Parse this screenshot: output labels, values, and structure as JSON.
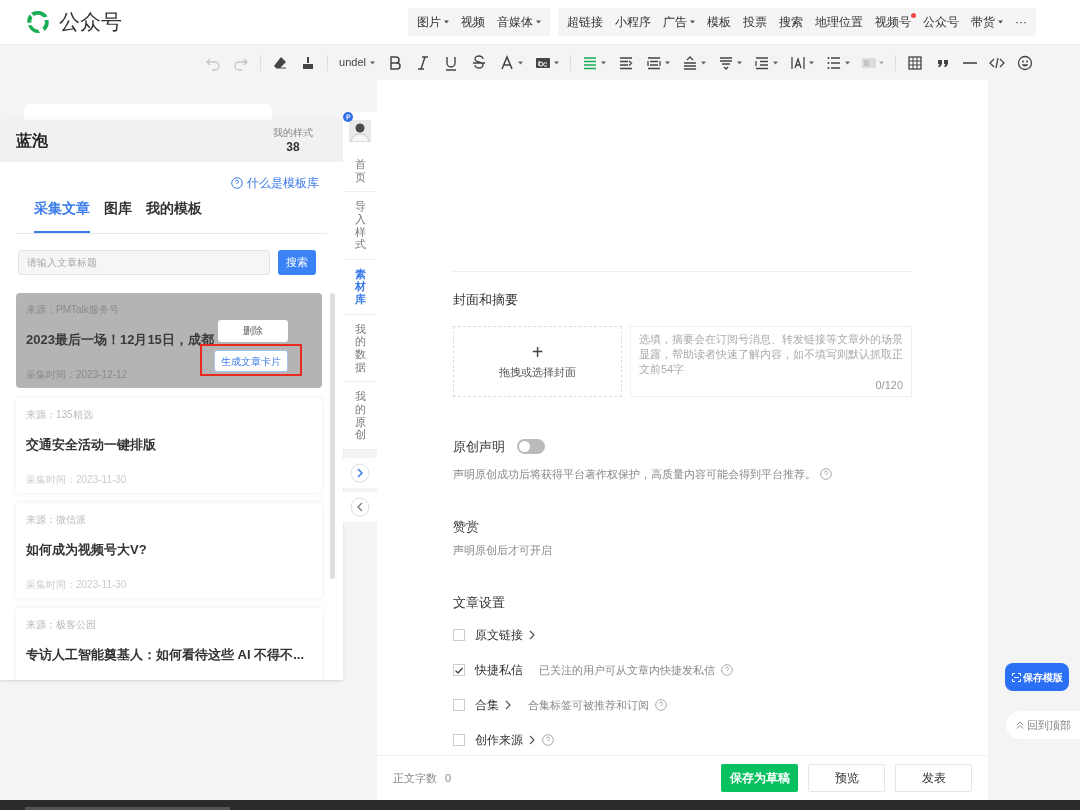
{
  "app": {
    "title": "公众号"
  },
  "insert_groups": [
    {
      "items": [
        {
          "label": "图片",
          "dropdown": true,
          "notification": false
        },
        {
          "label": "视频",
          "dropdown": false,
          "notification": false
        },
        {
          "label": "音媒体",
          "dropdown": true,
          "notification": false
        }
      ]
    },
    {
      "items": [
        {
          "label": "超链接",
          "dropdown": false,
          "notification": false
        },
        {
          "label": "小程序",
          "dropdown": false,
          "notification": false
        },
        {
          "label": "广告",
          "dropdown": true,
          "notification": false
        },
        {
          "label": "模板",
          "dropdown": false,
          "notification": false
        },
        {
          "label": "投票",
          "dropdown": false,
          "notification": false
        },
        {
          "label": "搜索",
          "dropdown": false,
          "notification": false
        },
        {
          "label": "地理位置",
          "dropdown": false,
          "notification": false
        },
        {
          "label": "视频号",
          "dropdown": false,
          "notification": true
        },
        {
          "label": "公众号",
          "dropdown": false,
          "notification": false
        },
        {
          "label": "带货",
          "dropdown": true,
          "notification": false
        },
        {
          "label": "···",
          "dropdown": false,
          "notification": false
        }
      ]
    }
  ],
  "toolbar": [
    {
      "kind": "undo",
      "disabled": true
    },
    {
      "kind": "redo",
      "disabled": true
    },
    {
      "kind": "separator"
    },
    {
      "kind": "eraser"
    },
    {
      "kind": "brush"
    },
    {
      "kind": "separator"
    },
    {
      "kind": "font",
      "label": "undel",
      "dropdown": true
    },
    {
      "kind": "bold"
    },
    {
      "kind": "italic"
    },
    {
      "kind": "underline"
    },
    {
      "kind": "strike"
    },
    {
      "kind": "color",
      "dropdown": true
    },
    {
      "kind": "highlight",
      "dropdown": true
    },
    {
      "kind": "separator"
    },
    {
      "kind": "align",
      "active": true,
      "dropdown": true
    },
    {
      "kind": "indent"
    },
    {
      "kind": "center",
      "dropdown": true
    },
    {
      "kind": "line-height",
      "dropdown": true
    },
    {
      "kind": "spacing",
      "dropdown": true
    },
    {
      "kind": "paragraph",
      "dropdown": true
    },
    {
      "kind": "letter-spacing",
      "dropdown": true
    },
    {
      "kind": "list",
      "dropdown": true
    },
    {
      "kind": "image-layout",
      "disabled": true,
      "dropdown": true
    },
    {
      "kind": "separator"
    },
    {
      "kind": "table"
    },
    {
      "kind": "quote"
    },
    {
      "kind": "divider"
    },
    {
      "kind": "code"
    },
    {
      "kind": "emoji"
    }
  ],
  "panel": {
    "title": "蓝泡",
    "styles_label": "我的样式",
    "styles_count": "38",
    "help_link": "什么是模板库",
    "tabs": [
      {
        "label": "采集文章",
        "selected": true
      },
      {
        "label": "图库",
        "selected": false
      },
      {
        "label": "我的模板",
        "selected": false
      }
    ],
    "search": {
      "placeholder": "请输入文章标题",
      "button": "搜索"
    },
    "articles": [
      {
        "source": "来源：PMTalk服务号",
        "title": "2023最后一场！12月15日，成都",
        "time": "采集时间：2023-12-12",
        "hovered": true,
        "actions": [
          {
            "label": "删除",
            "highlighted": false
          },
          {
            "label": "生成文章卡片",
            "highlighted": true
          }
        ]
      },
      {
        "source": "来源：135精选",
        "title": "交通安全活动一键排版",
        "time": "采集时间：2023-11-30",
        "hovered": false
      },
      {
        "source": "来源：微信派",
        "title": "如何成为视频号大V?",
        "time": "采集时间：2023-11-30",
        "hovered": false
      },
      {
        "source": "来源：极客公园",
        "title": "专访人工智能奠基人：如何看待这些 AI 不得不...",
        "hovered": false
      }
    ]
  },
  "side_tabs": [
    {
      "label": "首页",
      "selected": false
    },
    {
      "label": "导入样式",
      "selected": false
    },
    {
      "label": "素材库",
      "selected": true
    },
    {
      "label": "我的数据",
      "selected": false
    },
    {
      "label": "我的原创",
      "selected": false
    }
  ],
  "editor": {
    "cover": {
      "heading": "封面和摘要",
      "upload_icon": "+",
      "upload_label": "拖拽或选择封面",
      "summary_placeholder": "选填，摘要会在订阅号消息、转发链接等文章外的场景显露，帮助读者快速了解内容，如不填写则默认抓取正文前54字",
      "counter": "0/120"
    },
    "original": {
      "heading": "原创声明",
      "on": false,
      "description": "声明原创成功后将获得平台著作权保护，高质量内容可能会得到平台推荐。"
    },
    "reward": {
      "heading": "赞赏",
      "description": "声明原创后才可开启"
    },
    "settings": {
      "heading": "文章设置",
      "options": [
        {
          "label": "原文链接",
          "checked": false,
          "chevron": true,
          "help": false
        },
        {
          "label": "快捷私信",
          "checked": true,
          "chevron": false,
          "hint": "已关注的用户可从文章内快捷发私信",
          "help": true
        },
        {
          "label": "合集",
          "checked": false,
          "chevron": true,
          "hint": "合集标签可被推荐和订阅",
          "help": true
        },
        {
          "label": "创作来源",
          "checked": false,
          "chevron": true,
          "help": true
        }
      ]
    }
  },
  "footer": {
    "word_count_label": "正文字数",
    "word_count": "0",
    "buttons": [
      {
        "label": "保存为草稿",
        "primary": true
      },
      {
        "label": "预览",
        "primary": false
      },
      {
        "label": "发表",
        "primary": false
      }
    ]
  },
  "floating": {
    "save_template": "保存模版",
    "back_to_top": "回到顶部"
  }
}
